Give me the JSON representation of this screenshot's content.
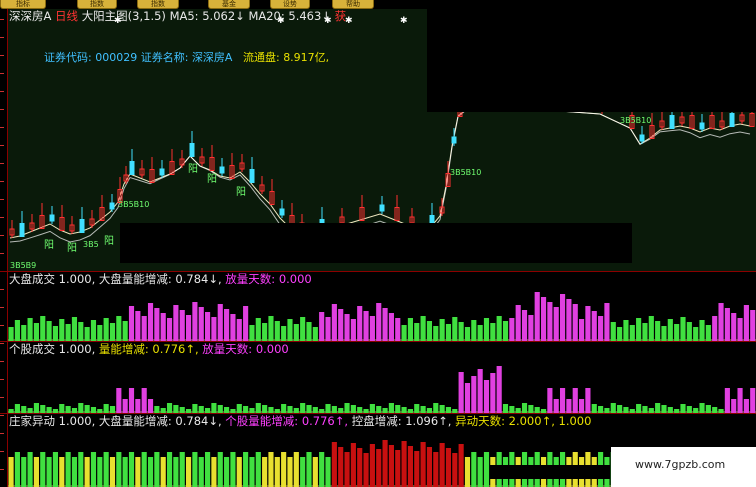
{
  "toolbar": {
    "buttons": [
      "指标",
      "指数",
      "指数",
      "基金",
      "设势",
      "帮助"
    ]
  },
  "header": {
    "stock_short": "深深房A",
    "period": "日线",
    "main_indicator": "大阳主图(3,1.5)",
    "ma5_label": "MA5:",
    "ma5_value": "5.062↓",
    "ma20_label": "MA20:",
    "ma20_value": "5.463↓",
    "trailing": "获"
  },
  "info": {
    "code_label": "证券代码:",
    "code_value": "000029",
    "name_label": "证券名称:",
    "name_value": "深深房A",
    "float_label": "流通盘:",
    "float_value": "8.917亿,"
  },
  "annotations": {
    "yang_labels": [
      "阳",
      "阳",
      "阳",
      "阳",
      "阳",
      "阳"
    ],
    "bar_labels": [
      "3B5B10",
      "3B5",
      "3B5B10",
      "3B5B10",
      "3B5B9"
    ]
  },
  "pane1": {
    "title": "大盘成交",
    "title_value": "1.000,",
    "ind1_label": "大盘量能增减:",
    "ind1_value": "0.784↓,",
    "ind2_label": "放量天数:",
    "ind2_value": "0.000"
  },
  "pane2": {
    "title": "个股成交",
    "title_value": "1.000,",
    "ind1_label": "量能增减:",
    "ind1_value": "0.776↑,",
    "ind2_label": "放量天数:",
    "ind2_value": "0.000"
  },
  "pane3": {
    "title": "庄家异动",
    "title_value": "1.000,",
    "ind1_label": "大盘量能增减:",
    "ind1_value": "0.784↓,",
    "ind2_label": "个股量能增减:",
    "ind2_value": "0.776↑,",
    "ind3_label": "控盘增减:",
    "ind3_value": "1.096↑,",
    "ind4_label": "异动天数:",
    "ind4_value": "2.000↑,",
    "ind5_value": "1.000"
  },
  "watermark": "www.7gpzb.com",
  "colors": {
    "up_candle": "#ff3030",
    "down_candle": "#40e0ff",
    "ma_line": "#f0e8c0",
    "vol_green": "#40e040",
    "vol_magenta": "#e040e0",
    "frame_red": "#8b0000"
  }
}
